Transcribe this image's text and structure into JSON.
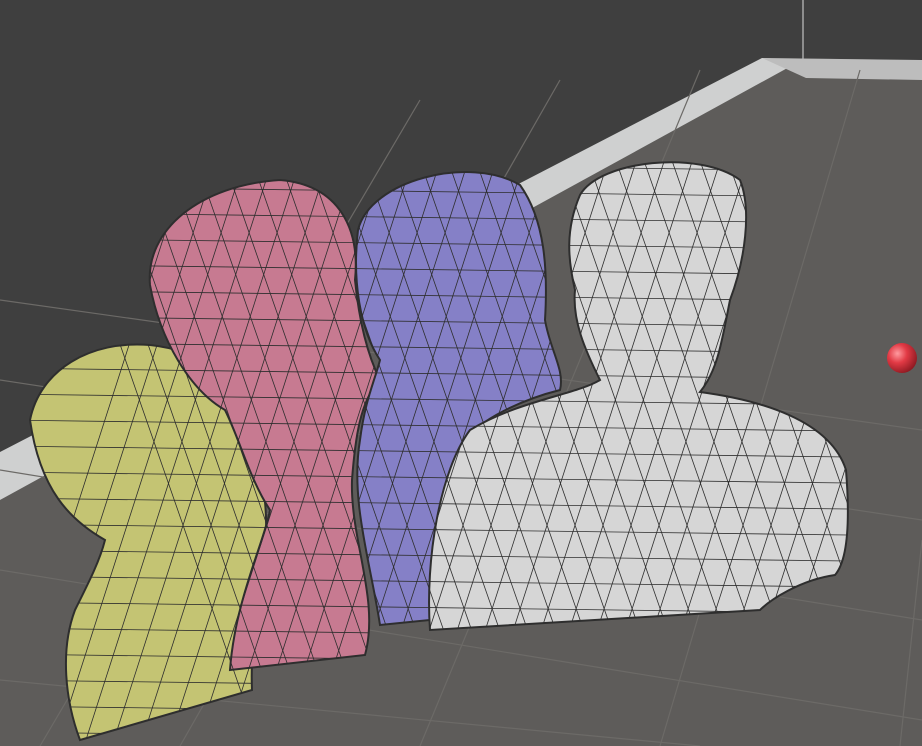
{
  "viewport": {
    "background_color": "#3f3f3f",
    "floor_color": "#5e5c5a",
    "grid_color": "#6c6a67",
    "wall_edge_color": "#cfd0d0",
    "wireframe_color": "#2e2e2e"
  },
  "models": [
    {
      "name": "green-bust",
      "fill": "#c4c473",
      "shade": "#8e8f4c"
    },
    {
      "name": "pink-bust",
      "fill": "#c77a91",
      "shade": "#8a4d60"
    },
    {
      "name": "purple-bust",
      "fill": "#8580c7",
      "shade": "#54508e"
    },
    {
      "name": "gray-bust",
      "fill": "#d6d6d6",
      "shade": "#8c8c8c"
    }
  ],
  "marker": {
    "color": "#e23a45"
  }
}
